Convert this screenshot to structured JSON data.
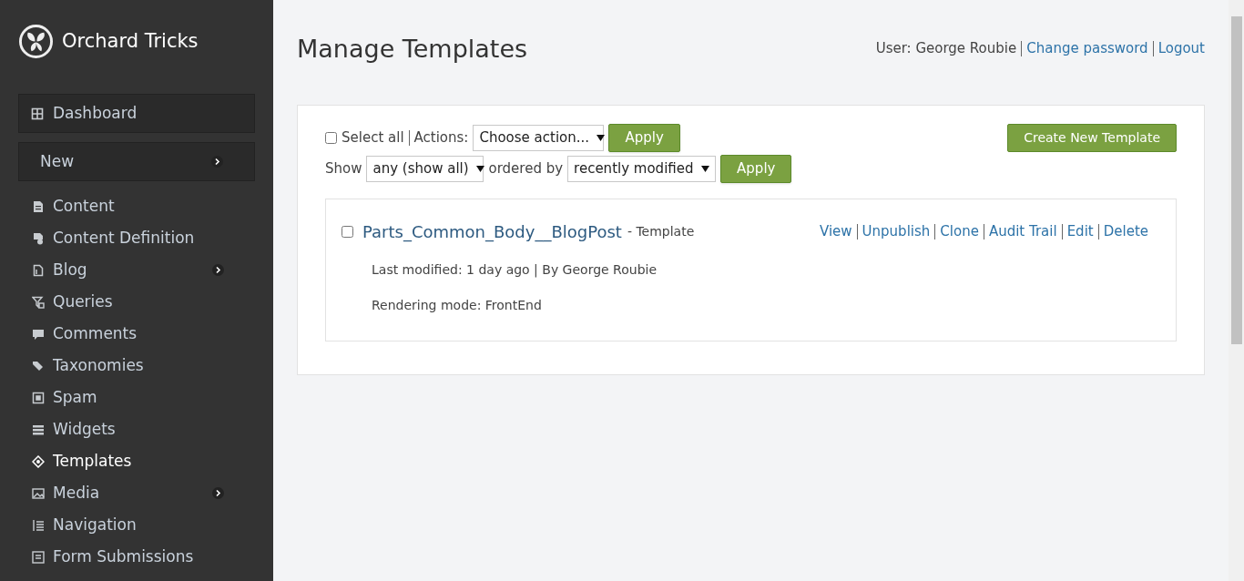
{
  "brand": {
    "name": "Orchard Tricks"
  },
  "sidebar": {
    "items": [
      {
        "label": "Dashboard",
        "kind": "box",
        "selected": false,
        "has_submenu": false
      },
      {
        "label": "New",
        "kind": "box",
        "selected": false,
        "has_submenu": true
      },
      {
        "label": "Content",
        "kind": "link",
        "selected": false,
        "has_submenu": false
      },
      {
        "label": "Content Definition",
        "kind": "link",
        "selected": false,
        "has_submenu": false
      },
      {
        "label": "Blog",
        "kind": "link",
        "selected": false,
        "has_submenu": true
      },
      {
        "label": "Queries",
        "kind": "link",
        "selected": false,
        "has_submenu": false
      },
      {
        "label": "Comments",
        "kind": "link",
        "selected": false,
        "has_submenu": false
      },
      {
        "label": "Taxonomies",
        "kind": "link",
        "selected": false,
        "has_submenu": false
      },
      {
        "label": "Spam",
        "kind": "link",
        "selected": false,
        "has_submenu": false
      },
      {
        "label": "Widgets",
        "kind": "link",
        "selected": false,
        "has_submenu": false
      },
      {
        "label": "Templates",
        "kind": "link",
        "selected": true,
        "has_submenu": false
      },
      {
        "label": "Media",
        "kind": "link",
        "selected": false,
        "has_submenu": true
      },
      {
        "label": "Navigation",
        "kind": "link",
        "selected": false,
        "has_submenu": false
      },
      {
        "label": "Form Submissions",
        "kind": "link",
        "selected": false,
        "has_submenu": false
      }
    ]
  },
  "page": {
    "title": "Manage Templates"
  },
  "user_bar": {
    "user": "User: George Roubie",
    "links": [
      "Change password",
      "Logout"
    ]
  },
  "toolbar": {
    "select_all": {
      "label": "Select all",
      "checked": false
    },
    "actions_label": "Actions:",
    "action_select": "Choose action...",
    "apply": "Apply",
    "show_label": "Show",
    "filter_select": "any (show all)",
    "ordered_label": "ordered by",
    "order_select": "recently modified",
    "apply_2": "Apply",
    "create": "Create New Template"
  },
  "items": [
    {
      "title": "Parts_Common_Body__BlogPost",
      "type": "- Template",
      "checked": false,
      "actions": [
        "View",
        "Unpublish",
        "Clone",
        "Audit Trail",
        "Edit",
        "Delete"
      ],
      "meta": "Last modified: 1 day ago | By George Roubie",
      "rendering": "Rendering mode: FrontEnd"
    }
  ]
}
